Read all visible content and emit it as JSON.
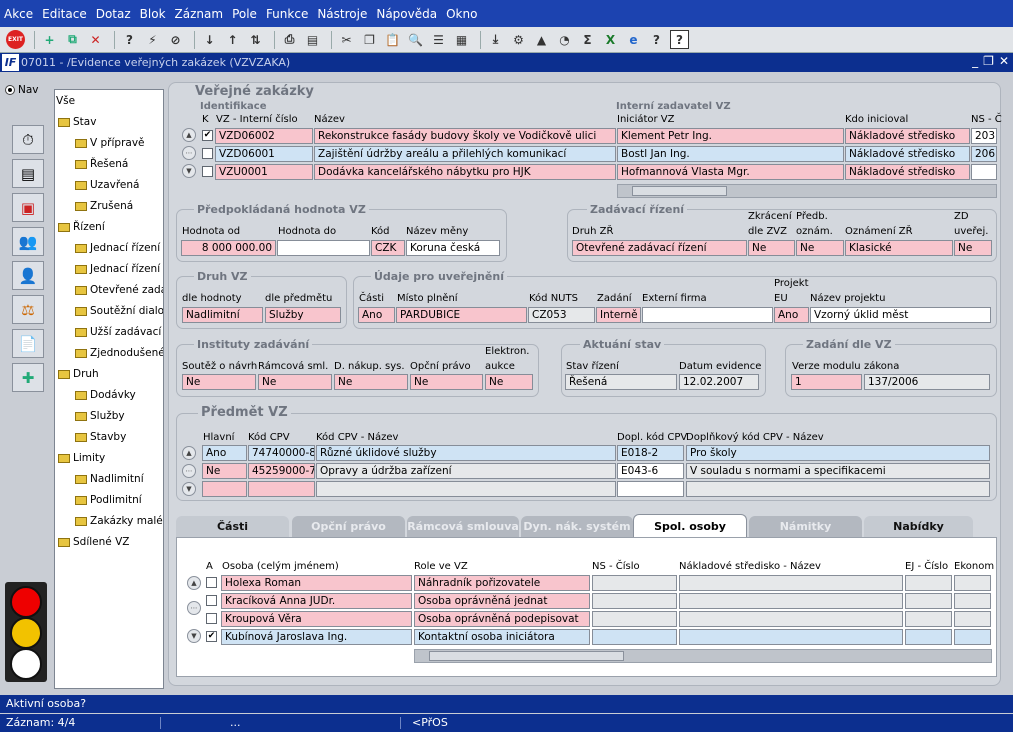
{
  "menu": [
    "Akce",
    "Editace",
    "Dotaz",
    "Blok",
    "Záznam",
    "Pole",
    "Funkce",
    "Nástroje",
    "Nápověda",
    "Okno"
  ],
  "window": {
    "title": "07011 - /Evidence veřejných zakázek (VZVZAKA)",
    "logo": "IF"
  },
  "left": {
    "nav_label": "Nav"
  },
  "tree": {
    "items": [
      "Vše",
      "Stav",
      "V přípravě",
      "Řešená",
      "Uzavřená",
      "Zrušená",
      "Řízení",
      "Jednací řízení b",
      "Jednací řízení s",
      "Otevřené zadá",
      "Soutěžní dialog",
      "Užší zadávací i",
      "Zjednodušené",
      "Druh",
      "Dodávky",
      "Služby",
      "Stavby",
      "Limity",
      "Nadlimitní",
      "Podlimitní",
      "Zakázky malého",
      "Sdílené VZ"
    ]
  },
  "vz": {
    "title": "Veřejné zakázky",
    "identifikace": "Identifikace",
    "interni_zadavatel": "Interní zadavatel VZ",
    "col_k": "K",
    "col_vz": "VZ - Interní číslo",
    "col_nazev": "Název",
    "col_iniciator": "Iniciátor VZ",
    "col_kdo": "Kdo inicioval",
    "col_ns": "NS - Č",
    "rows": [
      {
        "id": "VZD06002",
        "nazev": "Rekonstrukce fasády budovy školy ve Vodičkově ulici",
        "iniciator": "Klement Petr Ing.",
        "kdo": "Nákladové středisko",
        "ns": "203"
      },
      {
        "id": "VZD06001",
        "nazev": "Zajištění údržby areálu a přilehlých komunikací",
        "iniciator": "Bostl Jan Ing.",
        "kdo": "Nákladové středisko",
        "ns": "206"
      },
      {
        "id": "VZU0001",
        "nazev": "Dodávka kancelářského nábytku pro HJK",
        "iniciator": "Hofmannová Vlasta Mgr.",
        "kdo": "Nákladové středisko",
        "ns": ""
      }
    ]
  },
  "hodnota": {
    "title": "Předpokládaná hodnota VZ",
    "l_od": "Hodnota od",
    "l_do": "Hodnota do",
    "l_kod": "Kód",
    "l_mena": "Název měny",
    "od": "8 000 000.00",
    "do": "",
    "kod": "CZK",
    "mena": "Koruna česká"
  },
  "zadavaci": {
    "title": "Zadávací řízení",
    "l_druh": "Druh ZŘ",
    "l_zkr1": "Zkrácení",
    "l_zkr2": "dle ZVZ",
    "l_pred1": "Předb.",
    "l_pred2": "oznám.",
    "l_ozn": "Oznámení ZŘ",
    "l_zd1": "ZD",
    "l_zd2": "uveřej.",
    "druh": "Otevřené zadávací řízení",
    "zkr": "Ne",
    "pred": "Ne",
    "ozn": "Klasické",
    "zd": "Ne"
  },
  "druh": {
    "title": "Druh VZ",
    "l_hod": "dle hodnoty",
    "l_pred": "dle předmětu",
    "hod": "Nadlimitní",
    "pred": "Služby"
  },
  "uver": {
    "title": "Údaje pro uveřejnění",
    "l_casti": "Části",
    "l_misto": "Místo plnění",
    "l_nuts": "Kód NUTS",
    "l_zad": "Zadání",
    "l_firma": "Externí firma",
    "l_proj": "Projekt",
    "l_eu": "EU",
    "l_nazproj": "Název projektu",
    "casti": "Ano",
    "misto": "PARDUBICE",
    "nuts": "CZ053",
    "zad": "Interně",
    "firma": "",
    "eu": "Ano",
    "nazproj": "Vzorný úklid měst"
  },
  "instituty": {
    "title": "Instituty zadávání",
    "l1": "Soutěž o návrh",
    "l2": "Rámcová sml.",
    "l3": "D. nákup. sys.",
    "l4": "Opční právo",
    "l5a": "Elektron.",
    "l5b": "aukce",
    "v1": "Ne",
    "v2": "Ne",
    "v3": "Ne",
    "v4": "Ne",
    "v5": "Ne"
  },
  "stav": {
    "title": "Aktuání stav",
    "l_stav": "Stav řízení",
    "l_dat": "Datum evidence",
    "stav": "Řešená",
    "dat": "12.02.2007"
  },
  "zadani": {
    "title": "Zadání dle VZ",
    "l_ver": "Verze modulu",
    "l_zak": "zákona",
    "ver": "1",
    "zak": "137/2006"
  },
  "predmet": {
    "title": "Předmět VZ",
    "l_hl": "Hlavní",
    "l_kod": "Kód CPV",
    "l_naz": "Kód CPV - Název",
    "l_dopl": "Dopl. kód CPV",
    "l_doplnaz": "Doplňkový kód CPV - Název",
    "rows": [
      {
        "hl": "Ano",
        "kod": "74740000-8",
        "naz": "Různé úklidové služby",
        "dopl": "E018-2",
        "doplnaz": "Pro školy"
      },
      {
        "hl": "Ne",
        "kod": "45259000-7",
        "naz": "Opravy a údržba zařízení",
        "dopl": "E043-6",
        "doplnaz": "V souladu s normami a specifikacemi"
      }
    ]
  },
  "tabs": [
    "Části",
    "Opční právo",
    "Rámcová smlouva",
    "Dyn. nák. systém",
    "Spol. osoby",
    "Námitky",
    "Nabídky"
  ],
  "osoby": {
    "l_a": "A",
    "l_os": "Osoba (celým jménem)",
    "l_role": "Role ve VZ",
    "l_ns": "NS - Číslo",
    "l_nsn": "Nákladové středisko - Název",
    "l_ej": "EJ - Číslo",
    "l_ek": "Ekonom",
    "rows": [
      {
        "os": "Holexa Roman",
        "role": "Náhradník pořizovatele"
      },
      {
        "os": "Kracíková Anna JUDr.",
        "role": "Osoba oprávněná jednat"
      },
      {
        "os": "Kroupová Věra",
        "role": "Osoba oprávněná podepisovat"
      },
      {
        "os": "Kubínová Jaroslava Ing.",
        "role": "Kontaktní osoba iniciátora"
      }
    ]
  },
  "status": {
    "line1": "Aktivní osoba?",
    "zaznam": "Záznam: 4/4",
    "dots": "...",
    "mode": "<PřOS"
  }
}
